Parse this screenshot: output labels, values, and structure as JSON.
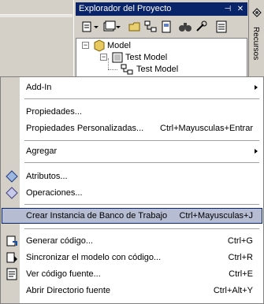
{
  "explorer": {
    "title": "Explorador del Proyecto",
    "pin_glyph": "⊣",
    "close_glyph": "✕",
    "side_tab": "Recursos"
  },
  "tree": [
    {
      "label": "Model",
      "expanded": true
    },
    {
      "label": "Test Model",
      "expanded": true
    },
    {
      "label": "Test Model"
    }
  ],
  "menu": [
    {
      "label": "Add-In",
      "submenu": true
    },
    {
      "label": "Propiedades..."
    },
    {
      "label": "Propiedades Personalizadas...",
      "shortcut": "Ctrl+Mayusculas+Entrar"
    },
    {
      "label": "Agregar",
      "submenu": true
    },
    {
      "label": "Atributos...",
      "icon": "attributes-icon"
    },
    {
      "label": "Operaciones...",
      "icon": "operations-icon"
    },
    {
      "label": "Crear Instancia de Banco de Trabajo",
      "shortcut": "Ctrl+Mayusculas+J",
      "highlighted": true
    },
    {
      "label": "Generar código...",
      "shortcut": "Ctrl+G",
      "icon": "generate-code-icon"
    },
    {
      "label": "Sincronizar el modelo con código...",
      "shortcut": "Ctrl+R",
      "icon": "synchronize-icon"
    },
    {
      "label": "Ver código fuente...",
      "shortcut": "Ctrl+E",
      "icon": "view-source-icon"
    },
    {
      "label": "Abrir Directorio fuente",
      "shortcut": "Ctrl+Alt+Y"
    }
  ],
  "colors": {
    "titlebar": "#0a246a",
    "highlight": "#b6bdd2",
    "chrome": "#d4d0c8"
  }
}
